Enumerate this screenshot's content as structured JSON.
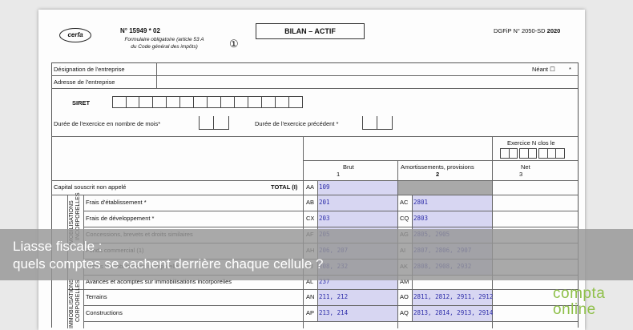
{
  "header": {
    "logo": "cerfa",
    "form_number": "N° 15949 * 02",
    "form_subtitle_1": "Formulaire obligatoire (article 53 A",
    "form_subtitle_2": "du Code général des impôts)",
    "circled": "①",
    "title": "BILAN – ACTIF",
    "dgfip_prefix": "DGFiP N° 2050-SD",
    "dgfip_year": "2020"
  },
  "identity": {
    "designation": "Désignation de l'entreprise",
    "neant": "Néant ☐",
    "star": "*",
    "adresse": "Adresse de l'entreprise",
    "siret": "SIRET",
    "duree": "Durée de l'exercice en nombre de mois*",
    "duree_prec": "Durée de l'exercice précédent *"
  },
  "columns": {
    "exercice": "Exercice N clos le",
    "brut": "Brut",
    "brut_num": "1",
    "amort": "Amortissements, provisions",
    "amort_num": "2",
    "net": "Net",
    "net_num": "3"
  },
  "rows": [
    {
      "label": "Capital souscrit non appelé",
      "total": "TOTAL (I)",
      "code1": "AA",
      "val1": "109",
      "code2": "",
      "val2": ""
    },
    {
      "label": "Frais d'établissement *",
      "code1": "AB",
      "val1": "201",
      "code2": "AC",
      "val2": "2801"
    },
    {
      "label": "Frais de développement *",
      "code1": "CX",
      "val1": "203",
      "code2": "CQ",
      "val2": "2803"
    },
    {
      "label": "Concessions, brevets et droits similaires",
      "code1": "AF",
      "val1": "205",
      "code2": "AG",
      "val2": "2805, 2905"
    },
    {
      "label": "Fonds commercial (1)",
      "code1": "AH",
      "val1": "206, 207",
      "code2": "AI",
      "val2": "2807, 2806, 2907"
    },
    {
      "label": "Autres immobilisations incorporelles",
      "code1": "AJ",
      "val1": "208, 232",
      "code2": "AK",
      "val2": "2808, 2908, 2932"
    },
    {
      "label": "Avances et acomptes sur immobilisations incorporelles",
      "code1": "AL",
      "val1": "237",
      "code2": "AM",
      "val2": ""
    },
    {
      "label": "Terrains",
      "code1": "AN",
      "val1": "211, 212",
      "code2": "AO",
      "val2": "2811, 2812, 2911, 2912"
    },
    {
      "label": "Constructions",
      "code1": "AP",
      "val1": "213, 214",
      "code2": "AQ",
      "val2": "2813, 2814, 2913, 2914"
    }
  ],
  "side_labels": {
    "incorp_1": "IMMOBILISATIONS",
    "incorp_2": "INCORPORELLES",
    "corp_1": "IMMOBILISATIONS",
    "corp_2": "CORPORELLES"
  },
  "overlay": {
    "line1": "Liasse fiscale :",
    "line2": "quels comptes se cachent derrière chaque cellule ?"
  },
  "brand": {
    "line1": "compta",
    "line2": "online"
  }
}
